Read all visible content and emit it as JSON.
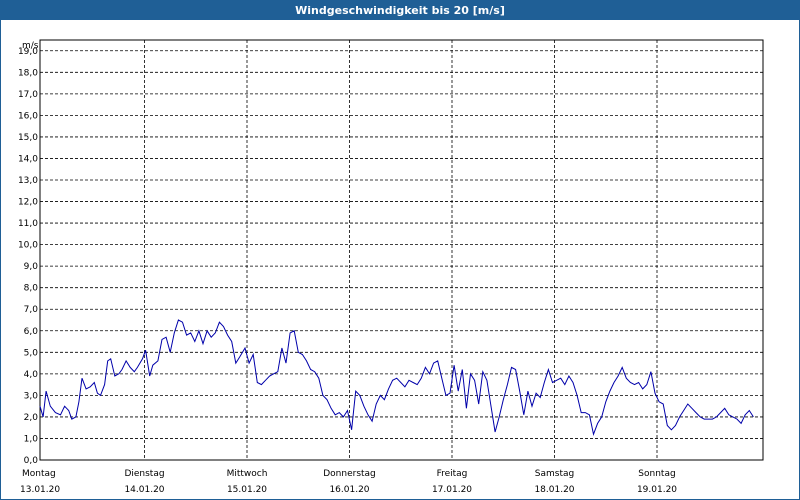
{
  "window": {
    "title": "Windgeschwindigkeit bis 20 [m/s]"
  },
  "colors": {
    "titlebar": "#1f5f96",
    "series": "#0000aa",
    "grid": "#000000"
  },
  "chart_data": {
    "type": "line",
    "title": "Windgeschwindigkeit bis 20 [m/s]",
    "ylabel": "m/s",
    "ylim": [
      0,
      19.5
    ],
    "grid": true,
    "y_ticks": [
      "0,0",
      "1,0",
      "2,0",
      "3,0",
      "4,0",
      "5,0",
      "6,0",
      "7,0",
      "8,0",
      "9,0",
      "10,0",
      "11,0",
      "12,0",
      "13,0",
      "14,0",
      "15,0",
      "16,0",
      "17,0",
      "18,0",
      "19,0"
    ],
    "x_ticks": [
      {
        "day": "Montag",
        "date": "13.01.20"
      },
      {
        "day": "Dienstag",
        "date": "14.01.20"
      },
      {
        "day": "Mittwoch",
        "date": "15.01.20"
      },
      {
        "day": "Donnerstag",
        "date": "16.01.20"
      },
      {
        "day": "Freitag",
        "date": "17.01.20"
      },
      {
        "day": "Samstag",
        "date": "18.01.20"
      },
      {
        "day": "Sonntag",
        "date": "19.01.20"
      }
    ],
    "series": [
      {
        "x": [
          0,
          0.03,
          0.06,
          0.1,
          0.15,
          0.2,
          0.24,
          0.28,
          0.31,
          0.35,
          0.38,
          0.41,
          0.45,
          0.49,
          0.53,
          0.56,
          0.59,
          0.63,
          0.66,
          0.69,
          0.73,
          0.77,
          0.8,
          0.84,
          0.88,
          0.92,
          0.95,
          1,
          1.03,
          1.07,
          1.1,
          1.15,
          1.19,
          1.23,
          1.27,
          1.31,
          1.35,
          1.39,
          1.43,
          1.47,
          1.51,
          1.55,
          1.59,
          1.63,
          1.67,
          1.71,
          1.75,
          1.79,
          1.83,
          1.87,
          1.91,
          1.95,
          2,
          2.04,
          2.08,
          2.12,
          2.16,
          2.2,
          2.24,
          2.28,
          2.32,
          2.36,
          2.4,
          2.44,
          2.48,
          2.52,
          2.56,
          2.6,
          2.64,
          2.68,
          2.72,
          2.76,
          2.8,
          2.84,
          2.88,
          2.92,
          2.96,
          3,
          3.04,
          3.08,
          3.12,
          3.16,
          3.2,
          3.24,
          3.28,
          3.32,
          3.36,
          3.4,
          3.44,
          3.48,
          3.52,
          3.56,
          3.6,
          3.64,
          3.68,
          3.72,
          3.76,
          3.8,
          3.84,
          3.88,
          3.92,
          3.96,
          4,
          4.04,
          4.08,
          4.12,
          4.16,
          4.2,
          4.24,
          4.28,
          4.32,
          4.36,
          4.4,
          4.44,
          4.48,
          4.52,
          4.56,
          4.6,
          4.64,
          4.68,
          4.72,
          4.76,
          4.8,
          4.84,
          4.88,
          4.92,
          4.96,
          5,
          5.04,
          5.08,
          5.12,
          5.16,
          5.2,
          5.24,
          5.28,
          5.32,
          5.36,
          5.4,
          5.44,
          5.48,
          5.52,
          5.56,
          5.6,
          5.64,
          5.68,
          5.72,
          5.76,
          5.8,
          5.84,
          5.88,
          5.92,
          5.96,
          6,
          6.04,
          6.08,
          6.12,
          6.16,
          6.2,
          6.24,
          6.28,
          6.32,
          6.36,
          6.4,
          6.44,
          6.48,
          6.52,
          6.56,
          6.6,
          6.64,
          6.68,
          6.72,
          6.76,
          6.8,
          6.84,
          6.88,
          6.92,
          6.96
        ],
        "y": [
          2.5,
          2.0,
          3.2,
          2.5,
          2.2,
          2.1,
          2.5,
          2.3,
          1.9,
          2.0,
          2.7,
          3.8,
          3.3,
          3.4,
          3.6,
          3.1,
          3.0,
          3.5,
          4.6,
          4.7,
          3.9,
          4.0,
          4.2,
          4.6,
          4.3,
          4.1,
          4.3,
          4.7,
          5.1,
          3.9,
          4.4,
          4.6,
          5.6,
          5.7,
          5.0,
          5.9,
          6.5,
          6.4,
          5.8,
          5.9,
          5.5,
          6.0,
          5.4,
          6.0,
          5.7,
          5.9,
          6.4,
          6.2,
          5.8,
          5.5,
          4.5,
          4.8,
          5.2,
          4.5,
          4.9,
          3.6,
          3.5,
          3.7,
          3.9,
          4.0,
          4.1,
          5.2,
          4.5,
          5.9,
          6.0,
          5.0,
          4.9,
          4.6,
          4.2,
          4.1,
          3.8,
          3.0,
          2.8,
          2.4,
          2.1,
          2.2,
          2.0,
          2.3,
          1.4,
          3.2,
          3.0,
          2.5,
          2.1,
          1.8,
          2.6,
          3.0,
          2.8,
          3.3,
          3.7,
          3.8,
          3.6,
          3.4,
          3.7,
          3.6,
          3.5,
          3.8,
          4.3,
          4.0,
          4.5,
          4.6,
          3.8,
          3.0,
          3.1,
          4.4,
          3.2,
          4.2,
          2.4,
          4.0,
          3.7,
          2.6,
          4.1,
          3.7,
          2.5,
          1.3,
          2.0,
          2.8,
          3.5,
          4.3,
          4.2,
          3.2,
          2.1,
          3.2,
          2.5,
          3.1,
          2.9,
          3.6,
          4.2,
          3.6,
          3.7,
          3.8,
          3.5,
          3.9,
          3.6,
          3.0,
          2.2,
          2.2,
          2.1,
          1.2,
          1.7,
          2.0,
          2.7,
          3.2,
          3.6,
          3.9,
          4.3,
          3.8,
          3.6,
          3.5,
          3.6,
          3.3,
          3.5,
          4.1,
          3.1,
          2.7,
          2.6,
          1.6,
          1.4,
          1.6,
          2.0,
          2.3,
          2.6,
          2.4,
          2.2,
          2.0,
          1.9,
          1.9,
          1.9,
          2.0,
          2.2,
          2.4,
          2.1,
          2.0,
          1.9,
          1.7,
          2.1,
          2.3,
          2.0
        ]
      }
    ]
  }
}
